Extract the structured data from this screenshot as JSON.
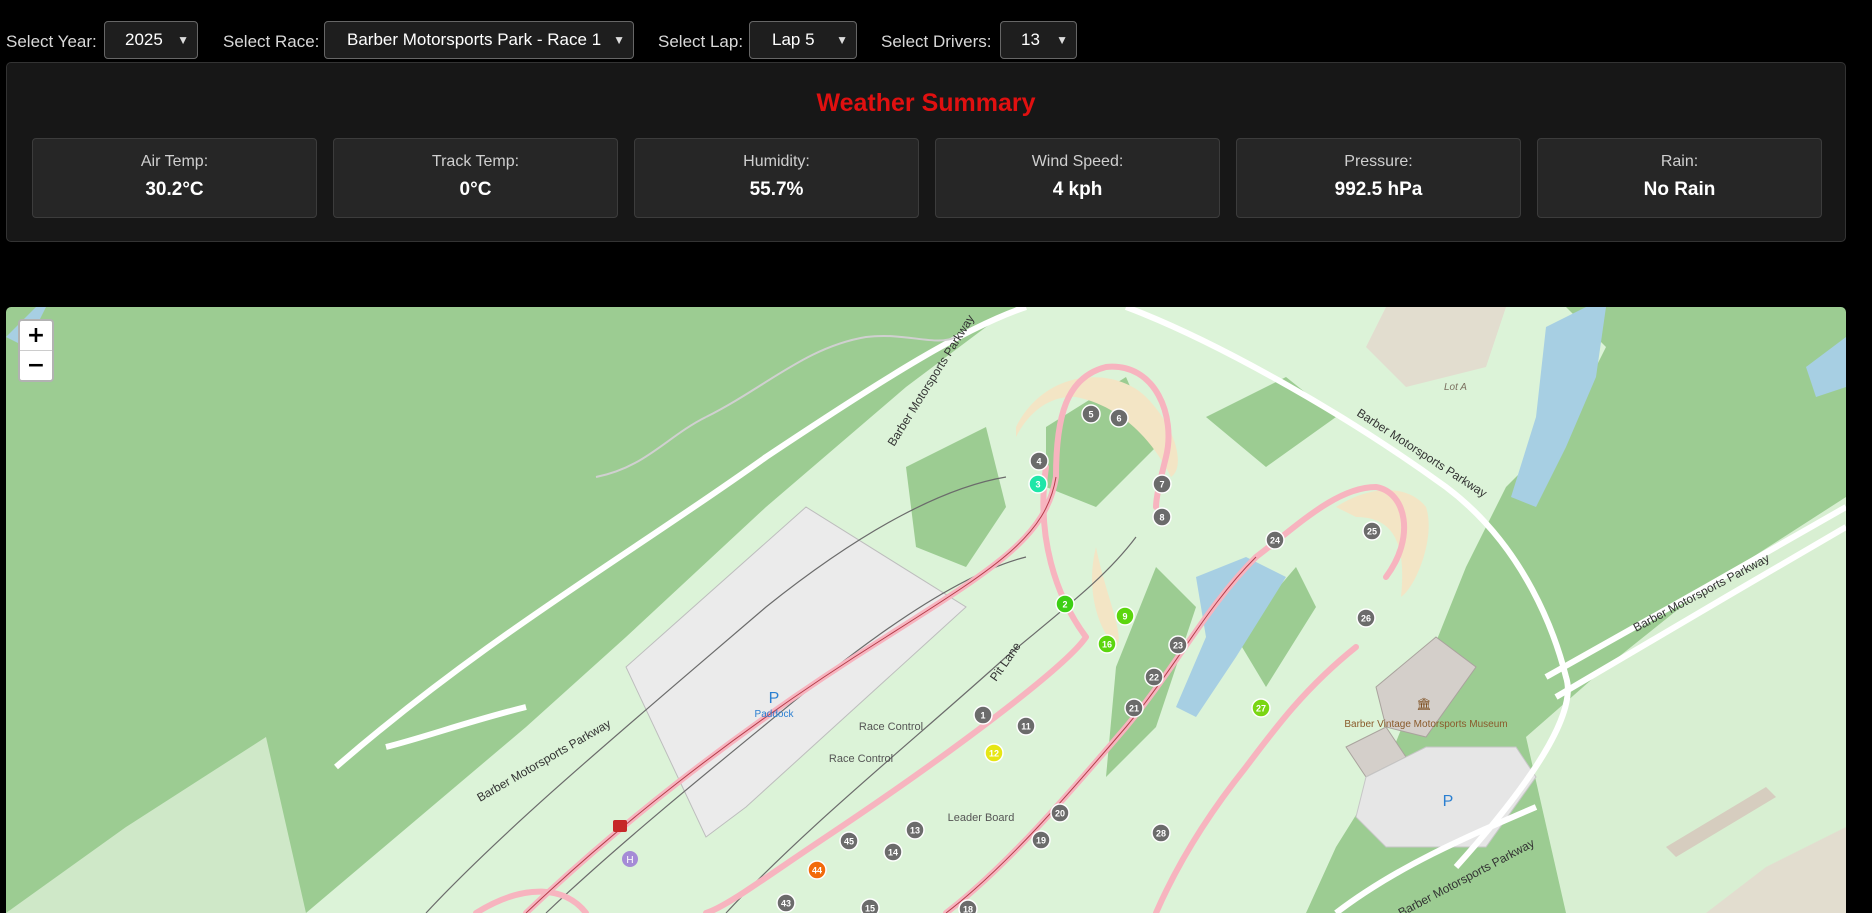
{
  "controls": {
    "year_label": "Select Year:",
    "year_value": "2025",
    "race_label": "Select Race:",
    "race_value": "Barber Motorsports Park - Race 1",
    "lap_label": "Select Lap:",
    "lap_value": "Lap 5",
    "drivers_label": "Select Drivers:",
    "drivers_value": "13"
  },
  "weather": {
    "title": "Weather Summary",
    "cards": [
      {
        "label": "Air Temp:",
        "value": "30.2°C"
      },
      {
        "label": "Track Temp:",
        "value": "0°C"
      },
      {
        "label": "Humidity:",
        "value": "55.7%"
      },
      {
        "label": "Wind Speed:",
        "value": "4 kph"
      },
      {
        "label": "Pressure:",
        "value": "992.5 hPa"
      },
      {
        "label": "Rain:",
        "value": "No Rain"
      }
    ]
  },
  "map": {
    "zoom_in": "+",
    "zoom_out": "−",
    "labels": {
      "parkway1": "Barber Motorsports Parkway",
      "parkway2": "Barber Motorsports Parkway",
      "parkway3": "Barber Motorsports Parkway",
      "parkway4": "Barber Motorsports Parkway",
      "parkway5": "Barber Motorsports Parkway",
      "pit_lane": "Pit Lane",
      "paddock_p": "P",
      "paddock": "Paddock",
      "race_control1": "Race Control",
      "race_control2": "Race Control",
      "leader_board": "Leader Board",
      "museum": "Barber Vintage Motorsports Museum",
      "lot_a": "Lot A",
      "parking_p": "P",
      "heli": "H"
    },
    "turns": [
      "1",
      "4",
      "5",
      "6",
      "7",
      "8",
      "11",
      "13",
      "14",
      "15",
      "18",
      "19",
      "20",
      "21",
      "22",
      "23",
      "24",
      "25",
      "26",
      "28",
      "43",
      "45"
    ],
    "drivers": [
      {
        "num": "3",
        "color": "#1ee6a8"
      },
      {
        "num": "2",
        "color": "#3ccf14"
      },
      {
        "num": "9",
        "color": "#5bd60e"
      },
      {
        "num": "16",
        "color": "#5bd60e"
      },
      {
        "num": "12",
        "color": "#e6e614"
      },
      {
        "num": "27",
        "color": "#7ad613"
      },
      {
        "num": "44",
        "color": "#f26a0a"
      }
    ]
  }
}
